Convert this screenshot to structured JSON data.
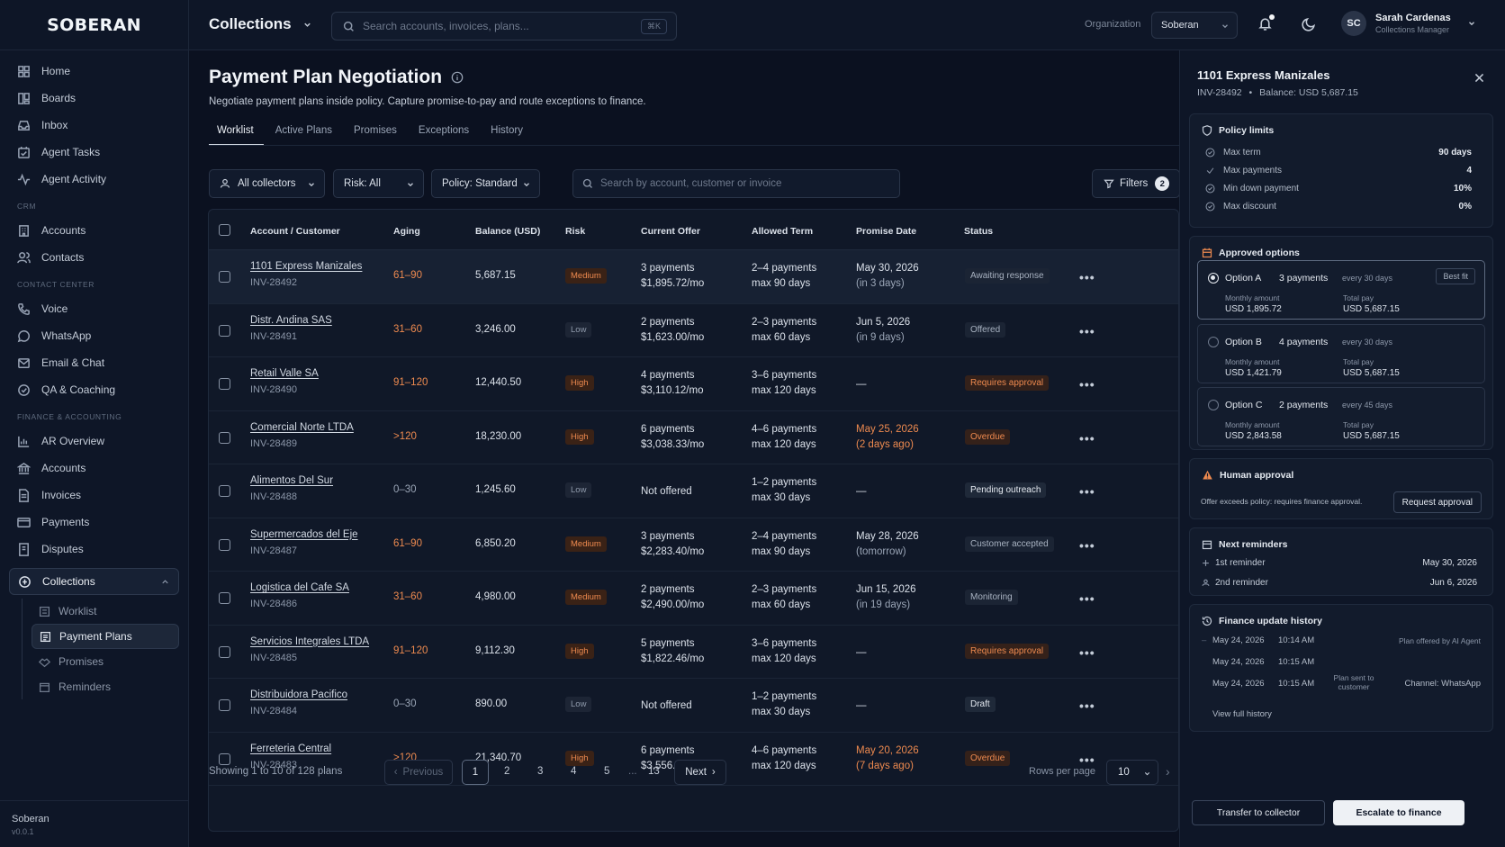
{
  "app": {
    "logo": "SOBERAN",
    "footer_name": "Soberan",
    "footer_version": "v0.0.1"
  },
  "sidebar": {
    "items_top": [
      {
        "label": "Home",
        "icon": "grid-icon"
      },
      {
        "label": "Boards",
        "icon": "boards-icon"
      },
      {
        "label": "Inbox",
        "icon": "inbox-icon"
      },
      {
        "label": "Agent Tasks",
        "icon": "tasks-icon"
      },
      {
        "label": "Agent Activity",
        "icon": "activity-icon"
      }
    ],
    "section_crm": "CRM",
    "items_crm": [
      {
        "label": "Accounts"
      },
      {
        "label": "Contacts"
      }
    ],
    "section_contact": "CONTACT CENTER",
    "items_contact": [
      {
        "label": "Voice"
      },
      {
        "label": "WhatsApp"
      },
      {
        "label": "Email & Chat"
      },
      {
        "label": "QA & Coaching"
      }
    ],
    "section_finance": "FINANCE & ACCOUNTING",
    "items_finance": [
      {
        "label": "AR Overview"
      },
      {
        "label": "Accounts"
      },
      {
        "label": "Invoices"
      },
      {
        "label": "Payments"
      },
      {
        "label": "Disputes"
      }
    ],
    "collections": "Collections",
    "sub_items": [
      {
        "label": "Worklist"
      },
      {
        "label": "Payment Plans"
      },
      {
        "label": "Promises"
      },
      {
        "label": "Reminders"
      }
    ]
  },
  "topbar": {
    "title": "Collections",
    "search_placeholder": "Search accounts, invoices, plans...",
    "search_kbd": "⌘K",
    "org_label": "Organization",
    "org_value": "Soberan",
    "user_initials": "SC",
    "user_name": "Sarah Cardenas",
    "user_role": "Collections Manager"
  },
  "page": {
    "title": "Payment Plan Negotiation",
    "subtitle": "Negotiate payment plans inside policy. Capture promise-to-pay and route exceptions to finance.",
    "tabs": [
      "Worklist",
      "Active Plans",
      "Promises",
      "Exceptions",
      "History"
    ],
    "filters": {
      "collectors": "All collectors",
      "risk": "Risk: All",
      "policy": "Policy: Standard",
      "search_placeholder": "Search by account, customer or invoice",
      "filters_label": "Filters",
      "filters_count": "2"
    }
  },
  "table": {
    "headers": [
      "Account / Customer",
      "Aging",
      "Balance (USD)",
      "Risk",
      "Current Offer",
      "Allowed Term",
      "Promise Date",
      "Status"
    ],
    "rows": [
      {
        "name": "1101 Express Manizales",
        "inv": "INV-28492",
        "aging": "61–90",
        "aging_color": "#ee8a4f",
        "balance": "5,687.15",
        "risk": "Medium",
        "risk_class": "med",
        "offer1": "3 payments",
        "offer2": "$1,895.72/mo",
        "term1": "2–4 payments",
        "term2": "max 90 days",
        "promise1": "May 30, 2026",
        "promise2": "(in 3 days)",
        "promise_warn": false,
        "status": "Awaiting response",
        "status_class": "",
        "selected": true
      },
      {
        "name": "Distr. Andina SAS",
        "inv": "INV-28491",
        "aging": "31–60",
        "aging_color": "#ee8a4f",
        "balance": "3,246.00",
        "risk": "Low",
        "risk_class": "low",
        "offer1": "2 payments",
        "offer2": "$1,623.00/mo",
        "term1": "2–3 payments",
        "term2": "max 60 days",
        "promise1": "Jun 5, 2026",
        "promise2": "(in 9 days)",
        "promise_warn": false,
        "status": "Offered",
        "status_class": "",
        "selected": false
      },
      {
        "name": "Retail Valle SA",
        "inv": "INV-28490",
        "aging": "91–120",
        "aging_color": "#ee8a4f",
        "balance": "12,440.50",
        "risk": "High",
        "risk_class": "high",
        "offer1": "4 payments",
        "offer2": "$3,110.12/mo",
        "term1": "3–6 payments",
        "term2": "max 120 days",
        "promise1": "—",
        "promise2": "",
        "promise_warn": false,
        "status": "Requires approval",
        "status_class": "orange",
        "selected": false
      },
      {
        "name": "Comercial Norte LTDA",
        "inv": "INV-28489",
        "aging": ">120",
        "aging_color": "#ee8a4f",
        "balance": "18,230.00",
        "risk": "High",
        "risk_class": "high",
        "offer1": "6 payments",
        "offer2": "$3,038.33/mo",
        "term1": "4–6 payments",
        "term2": "max 120 days",
        "promise1": "May 25, 2026",
        "promise2": "(2 days ago)",
        "promise_warn": true,
        "status": "Overdue",
        "status_class": "orange",
        "selected": false
      },
      {
        "name": "Alimentos Del Sur",
        "inv": "INV-28488",
        "aging": "0–30",
        "aging_color": "#9aa5b6",
        "balance": "1,245.60",
        "risk": "Low",
        "risk_class": "low",
        "offer1": "Not offered",
        "offer2": "",
        "term1": "1–2 payments",
        "term2": "max 30 days",
        "promise1": "—",
        "promise2": "",
        "promise_warn": false,
        "status": "Pending outreach",
        "status_class": "white",
        "selected": false
      },
      {
        "name": "Supermercados del Eje",
        "inv": "INV-28487",
        "aging": "61–90",
        "aging_color": "#ee8a4f",
        "balance": "6,850.20",
        "risk": "Medium",
        "risk_class": "med",
        "offer1": "3 payments",
        "offer2": "$2,283.40/mo",
        "term1": "2–4 payments",
        "term2": "max 90 days",
        "promise1": "May 28, 2026",
        "promise2": "(tomorrow)",
        "promise_warn": false,
        "status": "Customer accepted",
        "status_class": "",
        "selected": false
      },
      {
        "name": "Logistica del Cafe SA",
        "inv": "INV-28486",
        "aging": "31–60",
        "aging_color": "#ee8a4f",
        "balance": "4,980.00",
        "risk": "Medium",
        "risk_class": "med",
        "offer1": "2 payments",
        "offer2": "$2,490.00/mo",
        "term1": "2–3 payments",
        "term2": "max 60 days",
        "promise1": "Jun 15, 2026",
        "promise2": "(in 19 days)",
        "promise_warn": false,
        "status": "Monitoring",
        "status_class": "",
        "selected": false
      },
      {
        "name": "Servicios Integrales LTDA",
        "inv": "INV-28485",
        "aging": "91–120",
        "aging_color": "#ee8a4f",
        "balance": "9,112.30",
        "risk": "High",
        "risk_class": "high",
        "offer1": "5 payments",
        "offer2": "$1,822.46/mo",
        "term1": "3–6 payments",
        "term2": "max 120 days",
        "promise1": "—",
        "promise2": "",
        "promise_warn": false,
        "status": "Requires approval",
        "status_class": "orange",
        "selected": false
      },
      {
        "name": "Distribuidora Pacifico",
        "inv": "INV-28484",
        "aging": "0–30",
        "aging_color": "#9aa5b6",
        "balance": "890.00",
        "risk": "Low",
        "risk_class": "low",
        "offer1": "Not offered",
        "offer2": "",
        "term1": "1–2 payments",
        "term2": "max 30 days",
        "promise1": "—",
        "promise2": "",
        "promise_warn": false,
        "status": "Draft",
        "status_class": "white",
        "selected": false
      },
      {
        "name": "Ferreteria Central",
        "inv": "INV-28483",
        "aging": ">120",
        "aging_color": "#ee8a4f",
        "balance": "21,340.70",
        "risk": "High",
        "risk_class": "high",
        "offer1": "6 payments",
        "offer2": "$3,556.78/mo",
        "term1": "4–6 payments",
        "term2": "max 120 days",
        "promise1": "May 20, 2026",
        "promise2": "(7 days ago)",
        "promise_warn": true,
        "status": "Overdue",
        "status_class": "orange",
        "selected": false
      }
    ]
  },
  "pagination": {
    "info": "Showing 1 to 10 of 128 plans",
    "previous": "Previous",
    "pages": [
      "1",
      "2",
      "3",
      "4",
      "5"
    ],
    "ellipsis": "...",
    "last": "13",
    "next": "Next",
    "rows_label": "Rows per page",
    "rows_value": "10"
  },
  "panel": {
    "title": "1101 Express Manizales",
    "invoice": "INV-28492",
    "balance": "Balance: USD 5,687.15",
    "policy_title": "Policy limits",
    "policy": [
      {
        "label": "Max term",
        "value": "90 days"
      },
      {
        "label": "Max payments",
        "value": "4"
      },
      {
        "label": "Min down payment",
        "value": "10%"
      },
      {
        "label": "Max discount",
        "value": "0%"
      }
    ],
    "options_title": "Approved options",
    "options": [
      {
        "name": "Option A",
        "payments": "3 payments",
        "every": "every 30 days",
        "badge": "Best fit",
        "monthly_label": "Monthly amount",
        "monthly": "USD 1,895.72",
        "total_label": "Total pay",
        "total": "USD 5,687.15",
        "selected": true
      },
      {
        "name": "Option B",
        "payments": "4 payments",
        "every": "every 30 days",
        "badge": "",
        "monthly_label": "Monthly amount",
        "monthly": "USD 1,421.79",
        "total_label": "Total pay",
        "total": "USD 5,687.15",
        "selected": false
      },
      {
        "name": "Option C",
        "payments": "2 payments",
        "every": "every 45 days",
        "badge": "",
        "monthly_label": "Monthly amount",
        "monthly": "USD 2,843.58",
        "total_label": "Total pay",
        "total": "USD 5,687.15",
        "selected": false
      }
    ],
    "approval_title": "Human approval",
    "approval_text": "Offer exceeds policy: requires finance approval.",
    "approval_button": "Request approval",
    "reminders_title": "Next reminders",
    "reminders": [
      {
        "label": "1st reminder",
        "date": "May 30, 2026"
      },
      {
        "label": "2nd reminder",
        "date": "Jun 6, 2026"
      }
    ],
    "history_title": "Finance update history",
    "history": [
      {
        "date": "May 24, 2026",
        "time": "10:14 AM",
        "event": "Plan offered by AI Agent"
      },
      {
        "date": "May 24, 2026",
        "time": "10:15 AM",
        "event": "Plan sent to customer"
      },
      {
        "date": "May 24, 2026",
        "time": "10:15 AM",
        "event": "Channel: WhatsApp"
      }
    ],
    "history_link": "View full history",
    "transfer_button": "Transfer to collector",
    "escalate_button": "Escalate to finance"
  }
}
